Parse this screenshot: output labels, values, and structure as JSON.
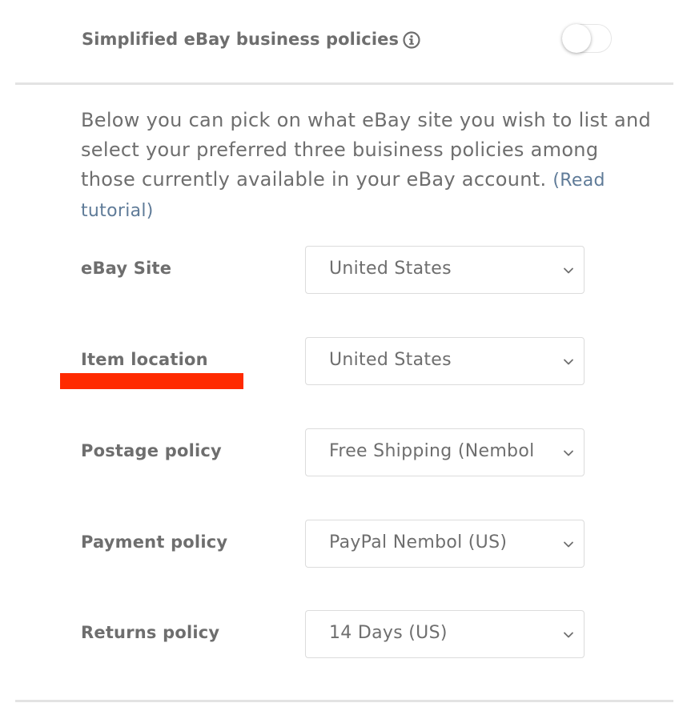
{
  "header": {
    "title": "Simplified eBay business policies",
    "info_icon": "info-icon",
    "toggle_state": "off"
  },
  "description": {
    "text": "Below you can pick on what eBay site you wish to list and select your preferred three buisiness policies among those currently available in your eBay account.",
    "link_text": "(Read tutorial)"
  },
  "fields": [
    {
      "label": "eBay Site",
      "value": "United States"
    },
    {
      "label": "Item location",
      "value": "United States"
    },
    {
      "label": "Postage policy",
      "value": "Free Shipping (Nembol"
    },
    {
      "label": "Payment policy",
      "value": "PayPal Nembol (US)"
    },
    {
      "label": "Returns policy",
      "value": "14 Days (US)"
    }
  ],
  "colors": {
    "text": "#6e6e6e",
    "link": "#5f7b98",
    "highlight": "#ff2a00",
    "divider": "#e3e3e3"
  }
}
